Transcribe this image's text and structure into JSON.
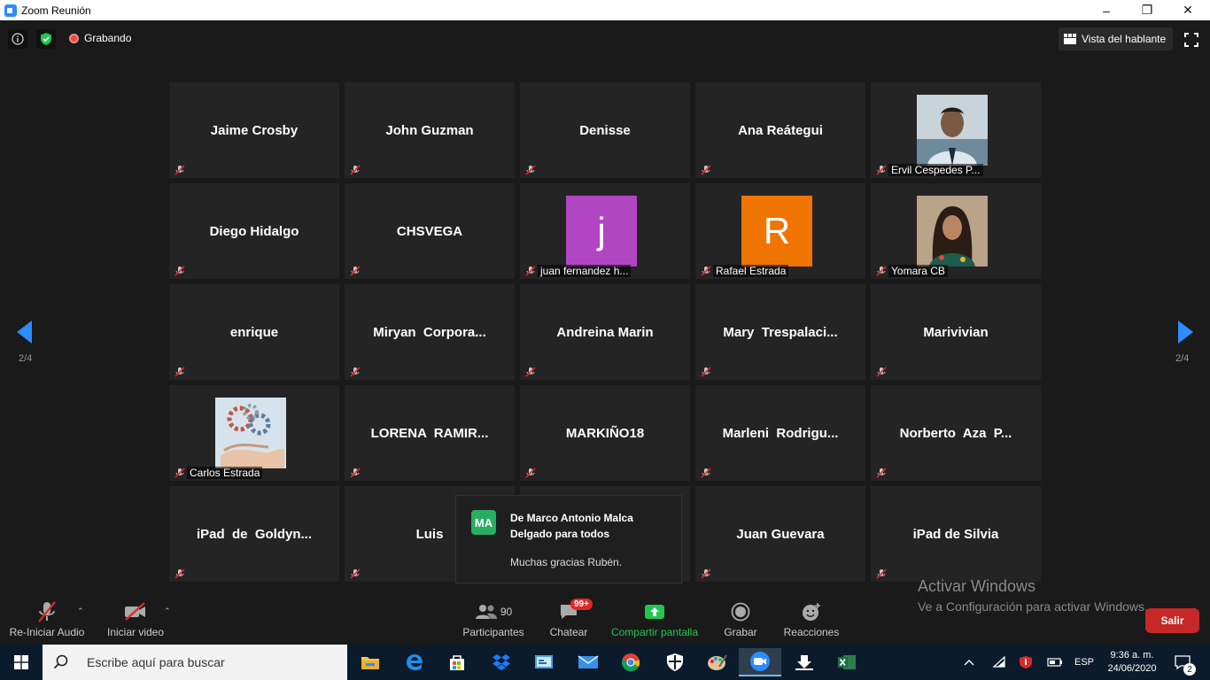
{
  "window": {
    "title": "Zoom Reunión",
    "minimize": "–",
    "restore": "❐",
    "close": "✕"
  },
  "topbar": {
    "recording_label": "Grabando",
    "speaker_view_label": "Vista del hablante"
  },
  "grid": {
    "page_indicator_left": "2/4",
    "page_indicator_right": "2/4",
    "tiles": [
      {
        "name": "Jaime Crosby",
        "label": "",
        "avatar": ""
      },
      {
        "name": "John Guzman",
        "label": "",
        "avatar": ""
      },
      {
        "name": "Denisse",
        "label": "",
        "avatar": ""
      },
      {
        "name": "Ana Reátegui",
        "label": "",
        "avatar": ""
      },
      {
        "name": "",
        "label": "Ervil Cespedes P...",
        "avatar": "photo-man"
      },
      {
        "name": "Diego Hidalgo",
        "label": "",
        "avatar": ""
      },
      {
        "name": "CHSVEGA",
        "label": "",
        "avatar": ""
      },
      {
        "name": "",
        "label": "juan fernandez h...",
        "avatar": "letter",
        "avatar_letter": "j",
        "avatar_color": "#b146c2"
      },
      {
        "name": "",
        "label": "Rafael Estrada",
        "avatar": "letter",
        "avatar_letter": "R",
        "avatar_color": "#f07400"
      },
      {
        "name": "",
        "label": "Yomara CB",
        "avatar": "photo-woman"
      },
      {
        "name": "enrique",
        "label": "",
        "avatar": ""
      },
      {
        "name": "Miryan  Corpora...",
        "label": "",
        "avatar": ""
      },
      {
        "name": "Andreina Marin",
        "label": "",
        "avatar": ""
      },
      {
        "name": "Mary  Trespalaci...",
        "label": "",
        "avatar": ""
      },
      {
        "name": "Marivivian",
        "label": "",
        "avatar": ""
      },
      {
        "name": "",
        "label": "Carlos Estrada",
        "avatar": "photo-gears"
      },
      {
        "name": "LORENA  RAMIR...",
        "label": "",
        "avatar": ""
      },
      {
        "name": "MARKIÑO18",
        "label": "",
        "avatar": ""
      },
      {
        "name": "Marleni  Rodrigu...",
        "label": "",
        "avatar": ""
      },
      {
        "name": "Norberto  Aza  P...",
        "label": "",
        "avatar": ""
      },
      {
        "name": "iPad  de  Goldyn...",
        "label": "",
        "avatar": ""
      },
      {
        "name": "Luis",
        "label": "",
        "avatar": ""
      },
      {
        "name": "",
        "label": "",
        "avatar": ""
      },
      {
        "name": "Juan Guevara",
        "label": "",
        "avatar": ""
      },
      {
        "name": "iPad de Silvia",
        "label": "",
        "avatar": ""
      }
    ]
  },
  "chat_popup": {
    "initials": "MA",
    "from": "De Marco Antonio Malca Delgado para todos",
    "message": "Muchas gracias Rubén."
  },
  "toolbar": {
    "audio_label": "Re-Iniciar Audio",
    "video_label": "Iniciar video",
    "participants_label": "Participantes",
    "participants_count": "90",
    "chat_label": "Chatear",
    "chat_badge": "99+",
    "share_label": "Compartir pantalla",
    "record_label": "Grabar",
    "reactions_label": "Reacciones",
    "leave_label": "Salir"
  },
  "watermark": {
    "line1": "Activar Windows",
    "line2": "Ve a Configuración para activar Windows."
  },
  "taskbar": {
    "search_placeholder": "Escribe aquí para buscar",
    "lang": "ESP",
    "time": "9:36 a. m.",
    "date": "24/06/2020",
    "notifications": "2"
  },
  "colors": {
    "accent_blue": "#2d8cff",
    "share_green": "#23c552",
    "leave_red": "#c62828",
    "badge_red": "#e02828"
  }
}
